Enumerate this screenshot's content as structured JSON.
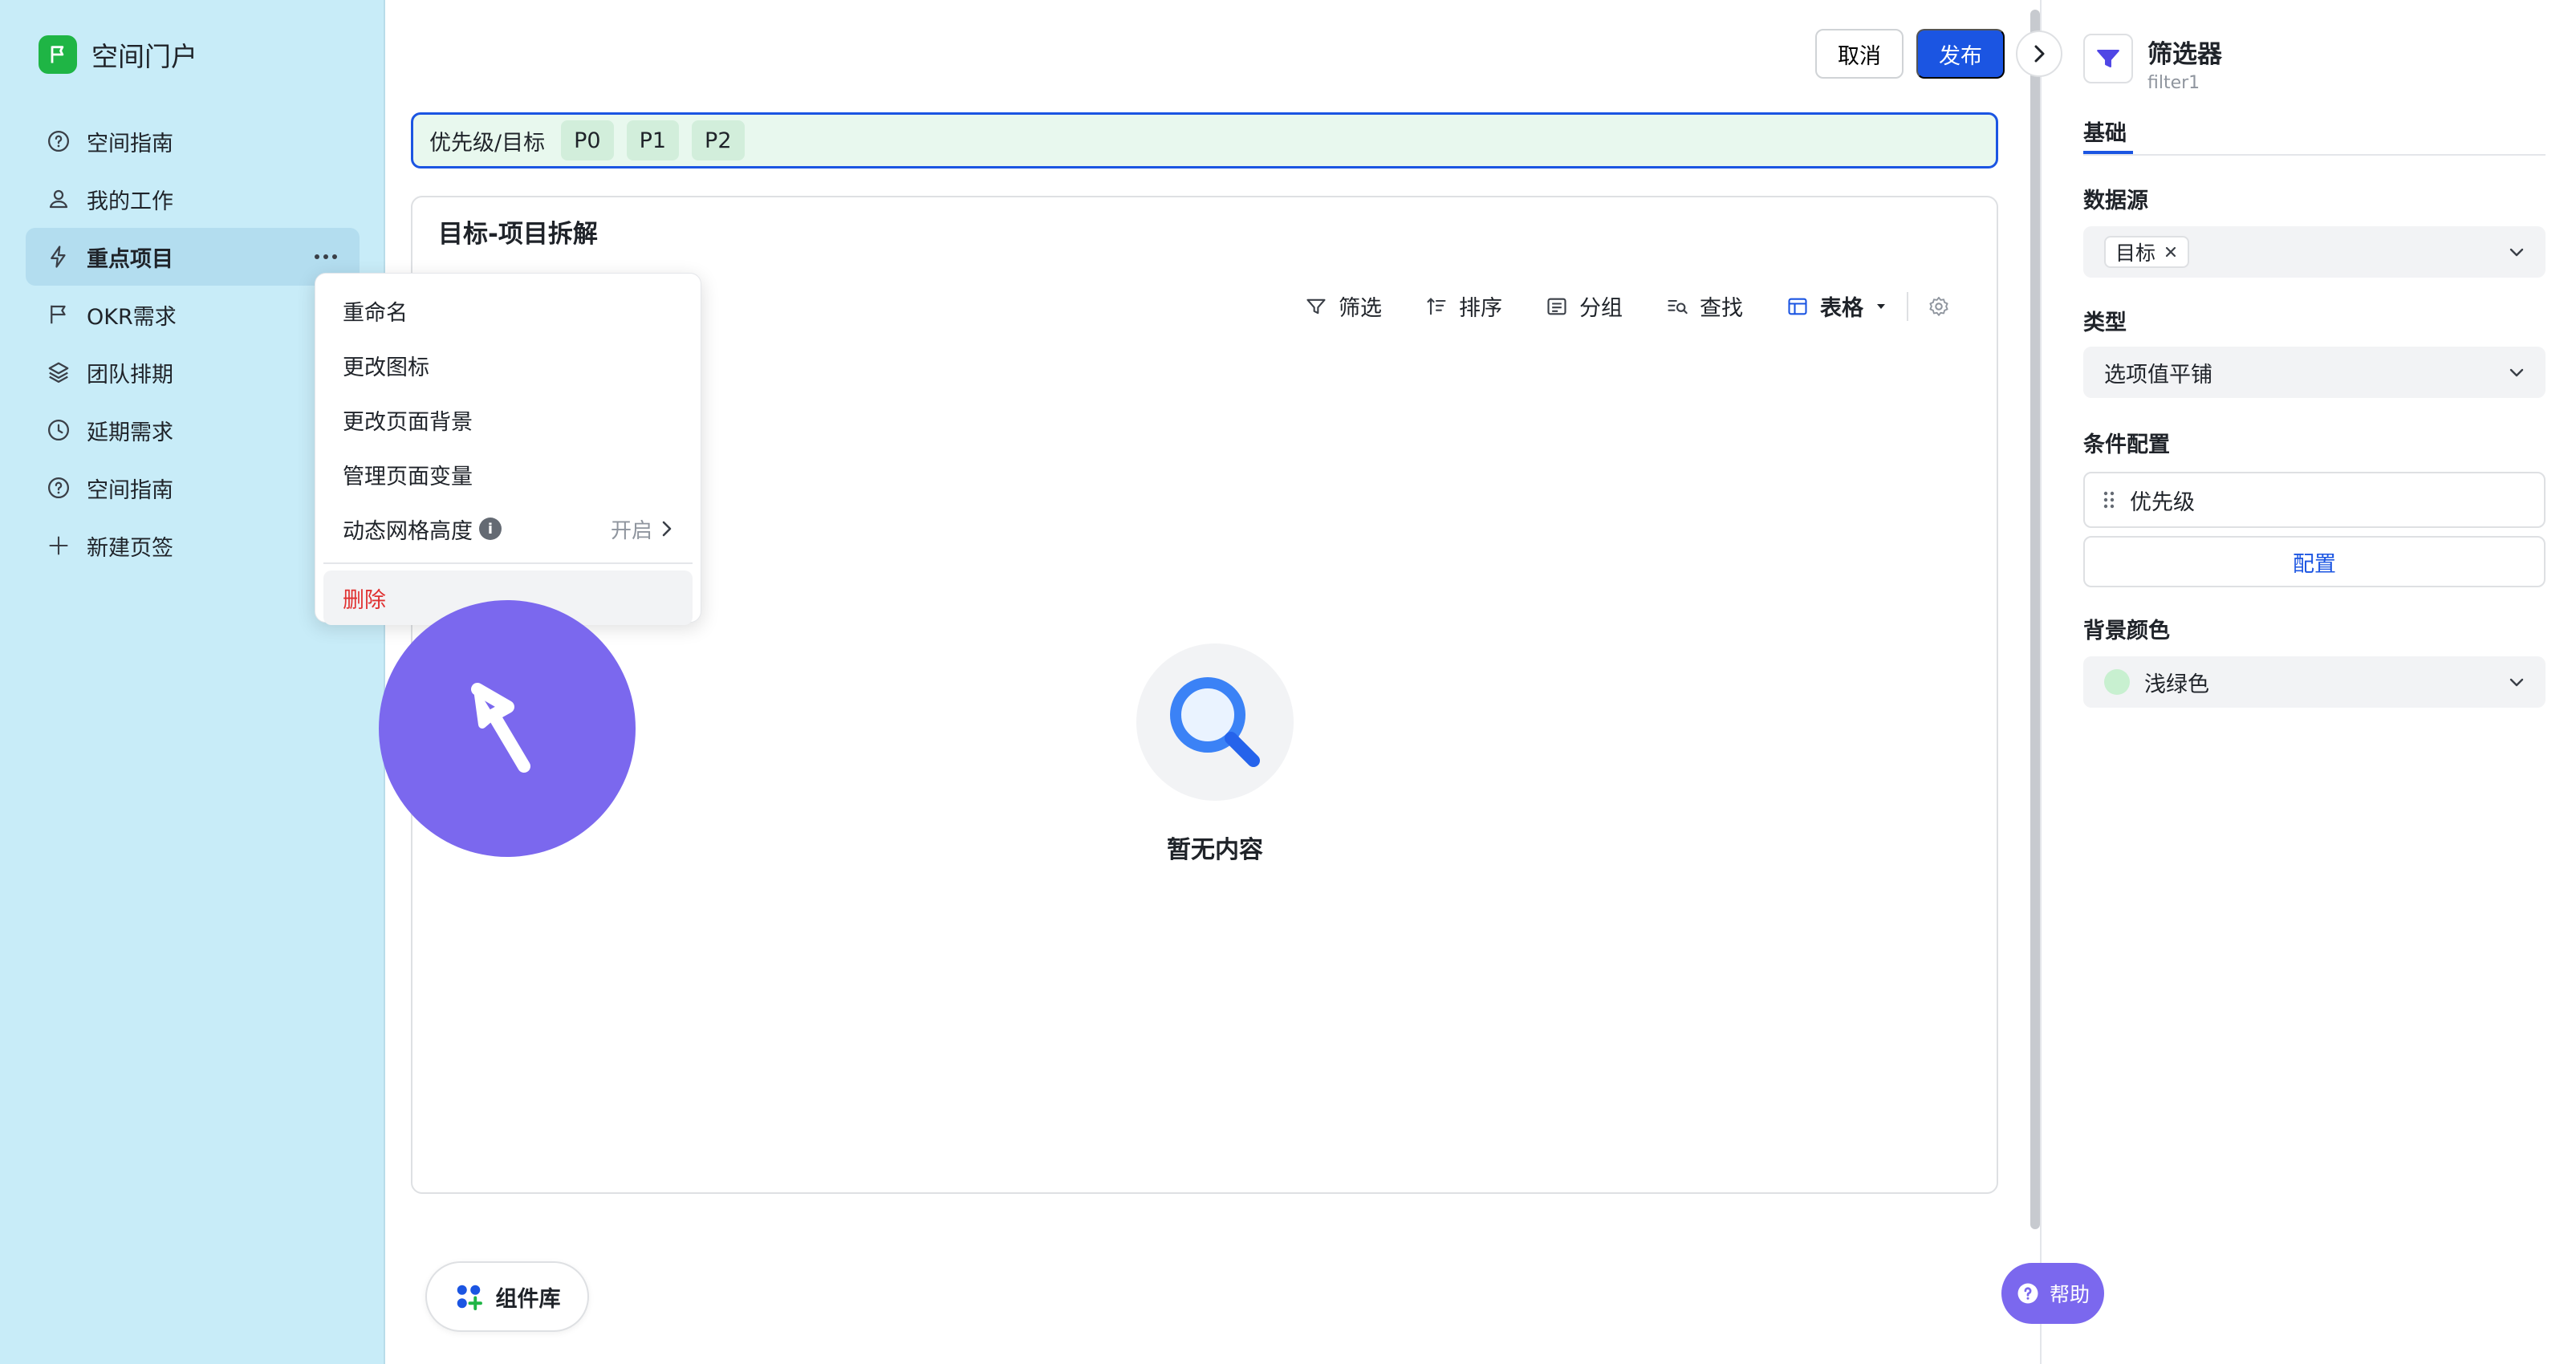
{
  "sidebar": {
    "title": "空间门户",
    "items": [
      {
        "label": "空间指南",
        "icon": "help-circle-icon"
      },
      {
        "label": "我的工作",
        "icon": "user-icon"
      },
      {
        "label": "重点项目",
        "icon": "lightning-icon"
      },
      {
        "label": "OKR需求",
        "icon": "flag-icon"
      },
      {
        "label": "团队排期",
        "icon": "layers-icon"
      },
      {
        "label": "延期需求",
        "icon": "clock-icon"
      },
      {
        "label": "空间指南",
        "icon": "help-circle-icon"
      },
      {
        "label": "新建页签",
        "icon": "plus-icon"
      }
    ]
  },
  "context_menu": {
    "rename": "重命名",
    "change_icon": "更改图标",
    "change_bg": "更改页面背景",
    "manage_vars": "管理页面变量",
    "dynamic_grid": "动态网格高度",
    "dynamic_grid_value": "开启",
    "delete": "删除"
  },
  "header": {
    "cancel": "取消",
    "publish": "发布"
  },
  "filter_bar": {
    "label": "优先级/目标",
    "chips": [
      "P0",
      "P1",
      "P2"
    ]
  },
  "card": {
    "title": "目标-项目拆解",
    "toolbar": {
      "filter": "筛选",
      "sort": "排序",
      "group": "分组",
      "find": "查找",
      "view": "表格"
    },
    "empty_text": "暂无内容"
  },
  "component_library": "组件库",
  "panel": {
    "title": "筛选器",
    "subtitle": "filter1",
    "tab": "基础",
    "datasource_label": "数据源",
    "datasource_tag": "目标",
    "type_label": "类型",
    "type_value": "选项值平铺",
    "condition_label": "条件配置",
    "condition_value": "优先级",
    "config_button": "配置",
    "bg_label": "背景颜色",
    "bg_value": "浅绿色",
    "bg_color": "#c8f0d0"
  },
  "help": "帮助",
  "colors": {
    "sidebar_bg": "#c8ecf8",
    "accent": "#1b55e2",
    "cursor": "#7b68ee"
  }
}
